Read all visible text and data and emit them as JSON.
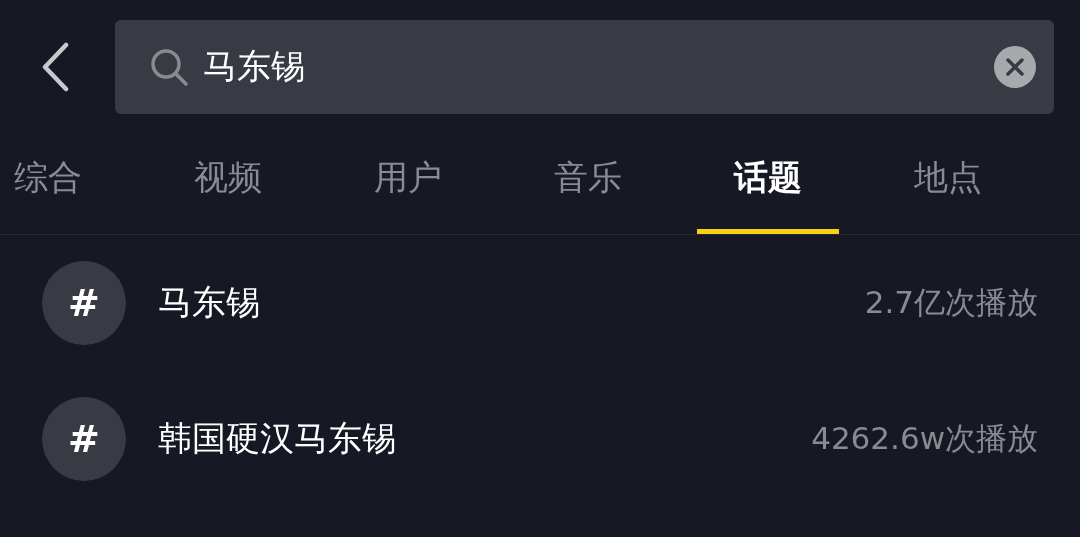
{
  "search": {
    "value": "马东锡"
  },
  "tabs": [
    {
      "label": "综合",
      "selected": false
    },
    {
      "label": "视频",
      "selected": false
    },
    {
      "label": "用户",
      "selected": false
    },
    {
      "label": "音乐",
      "selected": false
    },
    {
      "label": "话题",
      "selected": true
    },
    {
      "label": "地点",
      "selected": false
    }
  ],
  "topics": [
    {
      "symbol": "#",
      "name": "马东锡",
      "plays": "2.7亿次播放"
    },
    {
      "symbol": "#",
      "name": "韩国硬汉马东锡",
      "plays": "4262.6w次播放"
    }
  ]
}
